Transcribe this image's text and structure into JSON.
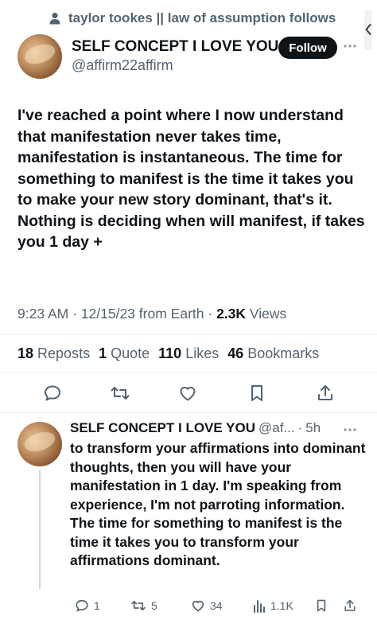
{
  "context": {
    "text": "taylor tookes || law of assumption follows"
  },
  "author": {
    "name": "SELF CONCEPT I LOVE YOU",
    "handle": "@affirm22affirm"
  },
  "follow_label": "Follow",
  "tweet": {
    "text": "I've reached a point where I now understand that manifestation never takes time, manifestation is instantaneous. The time for something to manifest is the time it takes you to make your new story dominant, that's it. Nothing is deciding when will manifest, if takes you 1 day +",
    "time": "9:23 AM",
    "date": "12/15/23",
    "source": "from Earth",
    "views_count": "2.3K",
    "views_label": "Views"
  },
  "stats": [
    {
      "count": "18",
      "label": "Reposts"
    },
    {
      "count": "1",
      "label": "Quote"
    },
    {
      "count": "110",
      "label": "Likes"
    },
    {
      "count": "46",
      "label": "Bookmarks"
    }
  ],
  "actions": [
    {
      "icon": "reply-icon"
    },
    {
      "icon": "repost-icon"
    },
    {
      "icon": "like-icon"
    },
    {
      "icon": "bookmark-icon"
    },
    {
      "icon": "share-icon"
    }
  ],
  "reply": {
    "name": "SELF CONCEPT I LOVE YOU",
    "handle": "@af...",
    "time": "5h",
    "text": "to transform your affirmations into dominant thoughts, then you will have your manifestation in 1 day. I'm speaking from experience, I'm not parroting information. The time for something to manifest is the time it takes you to transform your affirmations dominant.",
    "replies": "1",
    "reposts": "5",
    "likes": "34",
    "views": "1.1K"
  },
  "colors": {
    "text": "#0f1419",
    "secondary": "#536471",
    "divider": "#eff3f4",
    "follow_bg": "#0f1419"
  }
}
